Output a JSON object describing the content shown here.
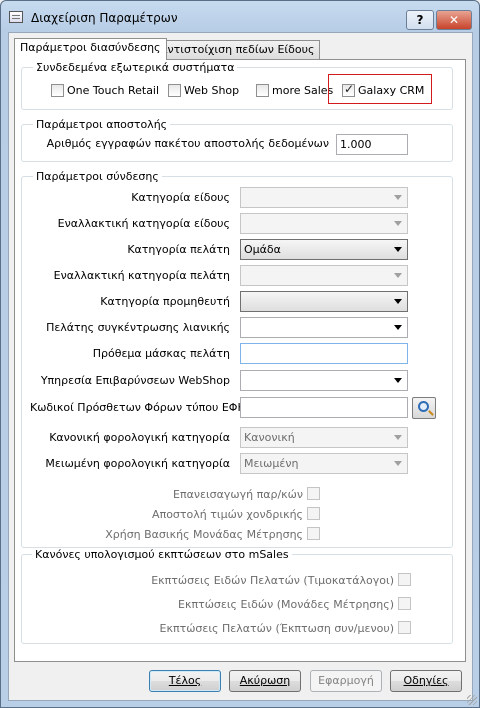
{
  "window": {
    "title": "Διαχείριση Παραμέτρων",
    "help_glyph": "?",
    "close_glyph": "✕"
  },
  "tabs": [
    {
      "label": "Παράμετροι διασύνδεσης",
      "active": true
    },
    {
      "label": "Αντιστοίχιση πεδίων Είδους",
      "active": false
    }
  ],
  "external": {
    "legend": "Συνδεδεμένα εξωτερικά συστήματα",
    "items": [
      {
        "label": "One Touch Retail",
        "checked": false
      },
      {
        "label": "Web Shop",
        "checked": false
      },
      {
        "label": "more Sales",
        "checked": false
      },
      {
        "label": "Galaxy CRM",
        "checked": true
      }
    ]
  },
  "send": {
    "legend": "Παράμετροι αποστολής",
    "packet_label": "Αριθμός εγγραφών πακέτου αποστολής δεδομένων",
    "packet_value": "1.000"
  },
  "connection": {
    "legend": "Παράμετροι σύνδεσης",
    "item_category": {
      "label": "Κατηγορία είδους",
      "value": ""
    },
    "alt_item_category": {
      "label": "Εναλλακτική κατηγορία είδους",
      "value": ""
    },
    "customer_category": {
      "label": "Κατηγορία πελάτη",
      "value": "Ομάδα"
    },
    "alt_customer_category": {
      "label": "Εναλλακτική κατηγορία πελάτη",
      "value": ""
    },
    "supplier_category": {
      "label": "Κατηγορία προμηθευτή",
      "value": ""
    },
    "retail_customer": {
      "label": "Πελάτης συγκέντρωσης λιανικής",
      "value": ""
    },
    "mask_prefix": {
      "label": "Πρόθεμα μάσκας πελάτη",
      "value": ""
    },
    "webshop_service": {
      "label": "Υπηρεσία Επιβαρύνσεων WebShop",
      "value": ""
    },
    "efk_codes": {
      "label": "Κωδικοί Πρόσθετων Φόρων τύπου ΕΦΚ",
      "value": ""
    },
    "normal_tax": {
      "label": "Κανονική φορολογική κατηγορία",
      "value": "Κανονική"
    },
    "reduced_tax": {
      "label": "Μειωμένη φορολογική κατηγορία",
      "value": "Μειωμένη"
    },
    "reimport_label": "Επανεισαγωγή παρ/κών",
    "wholesale_label": "Αποστολή τιμών χονδρικής",
    "base_unit_label": "Χρήση Βασικής Μονάδας Μέτρησης"
  },
  "discounts": {
    "legend": "Κανόνες υπολογισμού εκπτώσεων στο mSales",
    "items": [
      {
        "label": "Εκπτώσεις Ειδών Πελατών (Τιμοκατάλογοι)"
      },
      {
        "label": "Εκπτώσεις Ειδών (Μονάδες Μέτρησης)"
      },
      {
        "label": "Εκπτώσεις Πελατών (Έκπτωση συν/μενου)"
      }
    ]
  },
  "buttons": {
    "finish": "Τέλος",
    "cancel": "Ακύρωση",
    "apply": "Εφαρμογή",
    "guide": "Οδηγίες"
  }
}
